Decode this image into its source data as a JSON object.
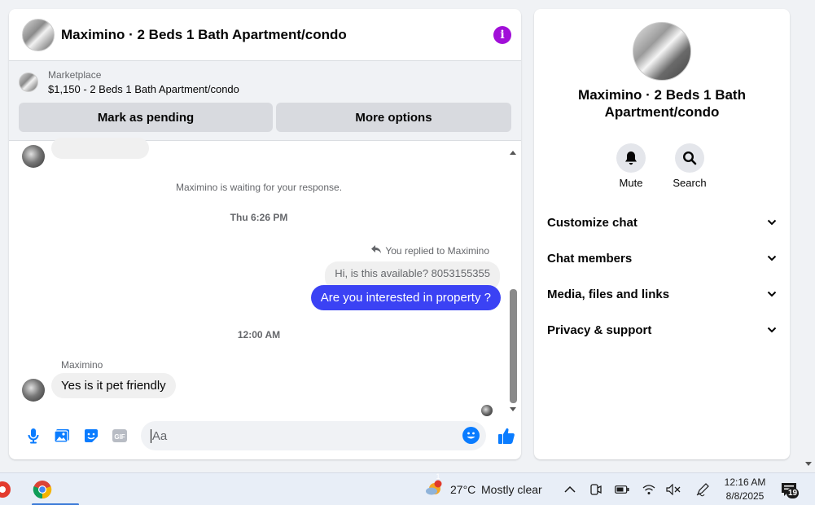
{
  "chat": {
    "title": "Maximino · 2 Beds 1 Bath Apartment/condo",
    "marketplace": {
      "label": "Marketplace",
      "listing": "$1,150 - 2 Beds 1 Bath Apartment/condo",
      "mark_pending_label": "Mark as pending",
      "more_options_label": "More options"
    },
    "messages": {
      "waiting_text": "Maximino is waiting for your response.",
      "time_1": "Thu 6:26 PM",
      "reply_note": "You replied to Maximino",
      "quoted_message": "Hi, is this available? 8053155355",
      "outgoing_message": "Are you interested in property ?",
      "time_2": "12:00 AM",
      "sender_name": "Maximino",
      "incoming_message": "Yes is it pet friendly"
    },
    "composer": {
      "placeholder": "Aa"
    }
  },
  "info_panel": {
    "title": "Maximino · 2 Beds 1 Bath Apartment/condo",
    "actions": [
      {
        "label": "Mute",
        "icon": "bell-icon"
      },
      {
        "label": "Search",
        "icon": "search-icon"
      }
    ],
    "sections": [
      {
        "label": "Customize chat"
      },
      {
        "label": "Chat members"
      },
      {
        "label": "Media, files and links"
      },
      {
        "label": "Privacy & support"
      }
    ]
  },
  "taskbar": {
    "weather_temp": "27°C",
    "weather_text": "Mostly clear",
    "weather_badge": "1",
    "time": "12:16 AM",
    "date": "8/8/2025",
    "notification_count": "19"
  },
  "colors": {
    "accent_purple": "#a10fd8",
    "outgoing_bubble": "#3b42f4",
    "messenger_blue": "#0a7cff"
  }
}
